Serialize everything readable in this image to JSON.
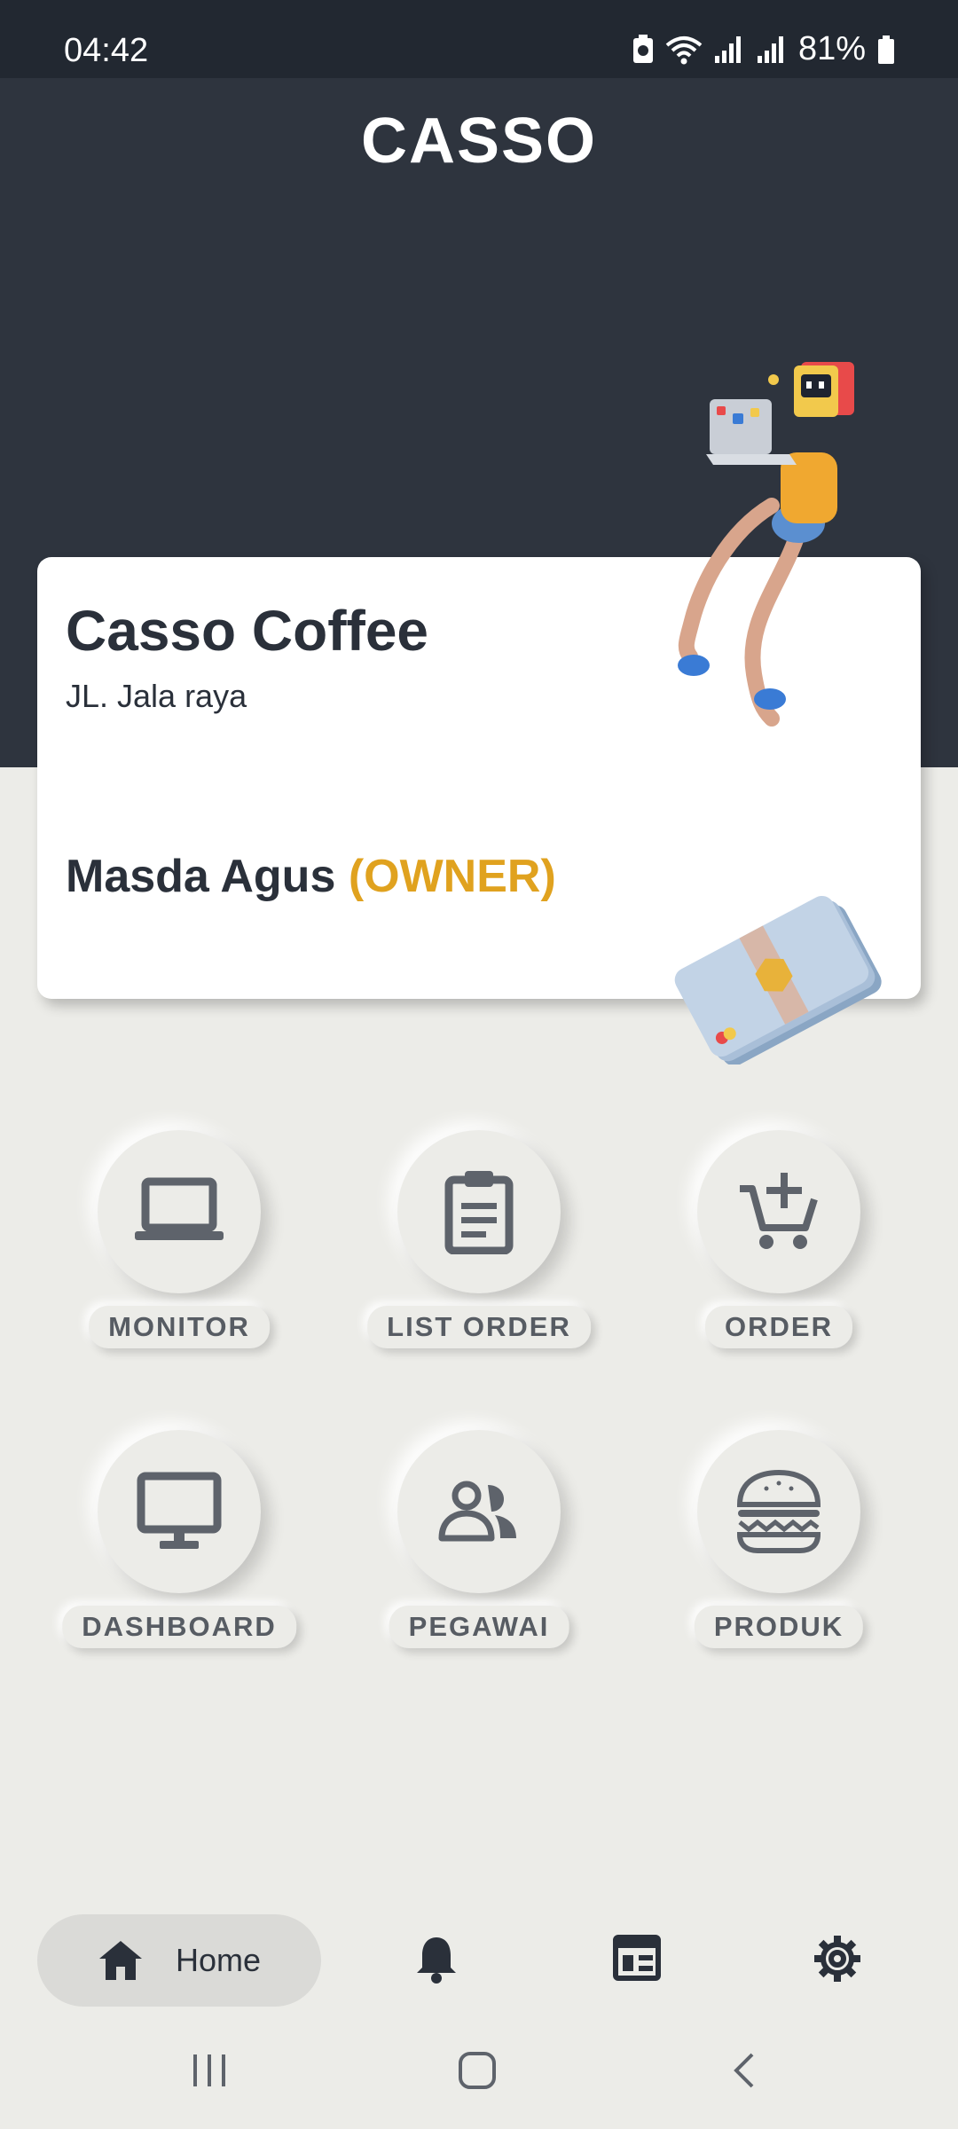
{
  "status_bar": {
    "time": "04:42",
    "battery_percent": "81%"
  },
  "app": {
    "title": "CASSO"
  },
  "store_card": {
    "store_name": "Casso Coffee",
    "address": "JL. Jala raya",
    "user_name": "Masda Agus",
    "role": "(OWNER)"
  },
  "menu": [
    {
      "label": "MONITOR",
      "icon": "laptop-icon"
    },
    {
      "label": "LIST ORDER",
      "icon": "clipboard-icon"
    },
    {
      "label": "ORDER",
      "icon": "add-cart-icon"
    },
    {
      "label": "DASHBOARD",
      "icon": "desktop-monitor-icon"
    },
    {
      "label": "PEGAWAI",
      "icon": "people-icon"
    },
    {
      "label": "PRODUK",
      "icon": "burger-icon"
    }
  ],
  "bottom_nav": {
    "home_label": "Home",
    "items": [
      "home-icon",
      "bell-icon",
      "calendar-list-icon",
      "gear-icon"
    ]
  },
  "colors": {
    "header_bg": "#2e343e",
    "accent": "#e0a21f",
    "page_bg": "#ecece8",
    "text_dark": "#2a303a",
    "label_text": "#575c63"
  }
}
